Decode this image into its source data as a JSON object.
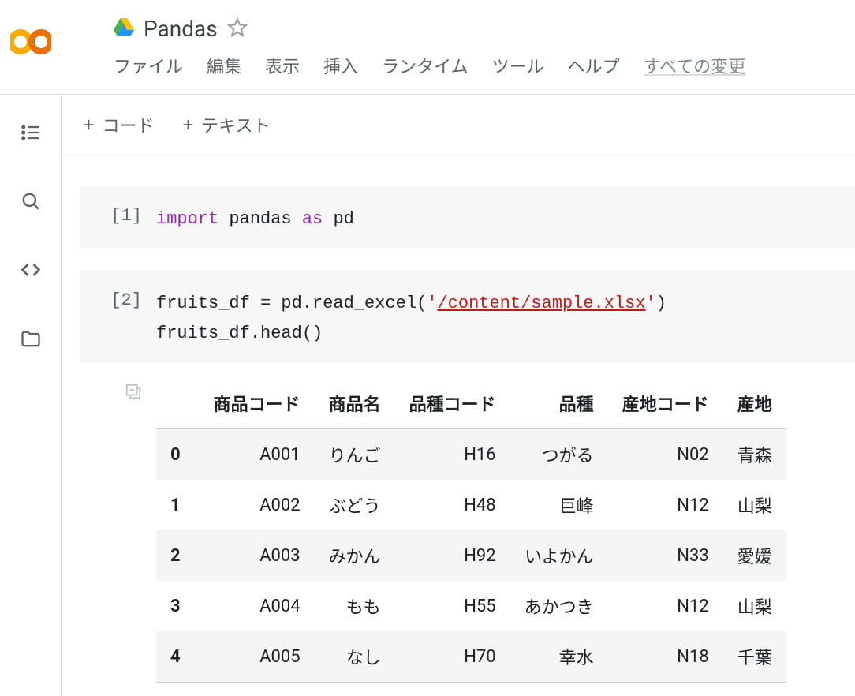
{
  "title": "Pandas",
  "menu": {
    "file": "ファイル",
    "edit": "編集",
    "view": "表示",
    "insert": "挿入",
    "runtime": "ランタイム",
    "tools": "ツール",
    "help": "ヘルプ",
    "status": "すべての変更"
  },
  "toolbar": {
    "code": "コード",
    "text": "テキスト"
  },
  "cells": [
    {
      "exec": "[1]",
      "code_tokens": [
        {
          "t": "import",
          "c": "kw-import"
        },
        {
          "t": " pandas ",
          "c": ""
        },
        {
          "t": "as",
          "c": "kw-as"
        },
        {
          "t": " pd",
          "c": ""
        }
      ]
    },
    {
      "exec": "[2]",
      "lines": [
        [
          {
            "t": "fruits_df = pd.read_excel(",
            "c": ""
          },
          {
            "t": "'",
            "c": "str"
          },
          {
            "t": "/content/sample.xlsx",
            "c": "str str-underline"
          },
          {
            "t": "'",
            "c": "str"
          },
          {
            "t": ")",
            "c": ""
          }
        ],
        [
          {
            "t": "fruits_df.head()",
            "c": ""
          }
        ]
      ]
    }
  ],
  "output_table": {
    "columns": [
      "商品コード",
      "商品名",
      "品種コード",
      "品種",
      "産地コード",
      "産地"
    ],
    "index": [
      "0",
      "1",
      "2",
      "3",
      "4"
    ],
    "rows": [
      [
        "A001",
        "りんご",
        "H16",
        "つがる",
        "N02",
        "青森"
      ],
      [
        "A002",
        "ぶどう",
        "H48",
        "巨峰",
        "N12",
        "山梨"
      ],
      [
        "A003",
        "みかん",
        "H92",
        "いよかん",
        "N33",
        "愛媛"
      ],
      [
        "A004",
        "もも",
        "H55",
        "あかつき",
        "N12",
        "山梨"
      ],
      [
        "A005",
        "なし",
        "H70",
        "幸水",
        "N18",
        "千葉"
      ]
    ]
  }
}
